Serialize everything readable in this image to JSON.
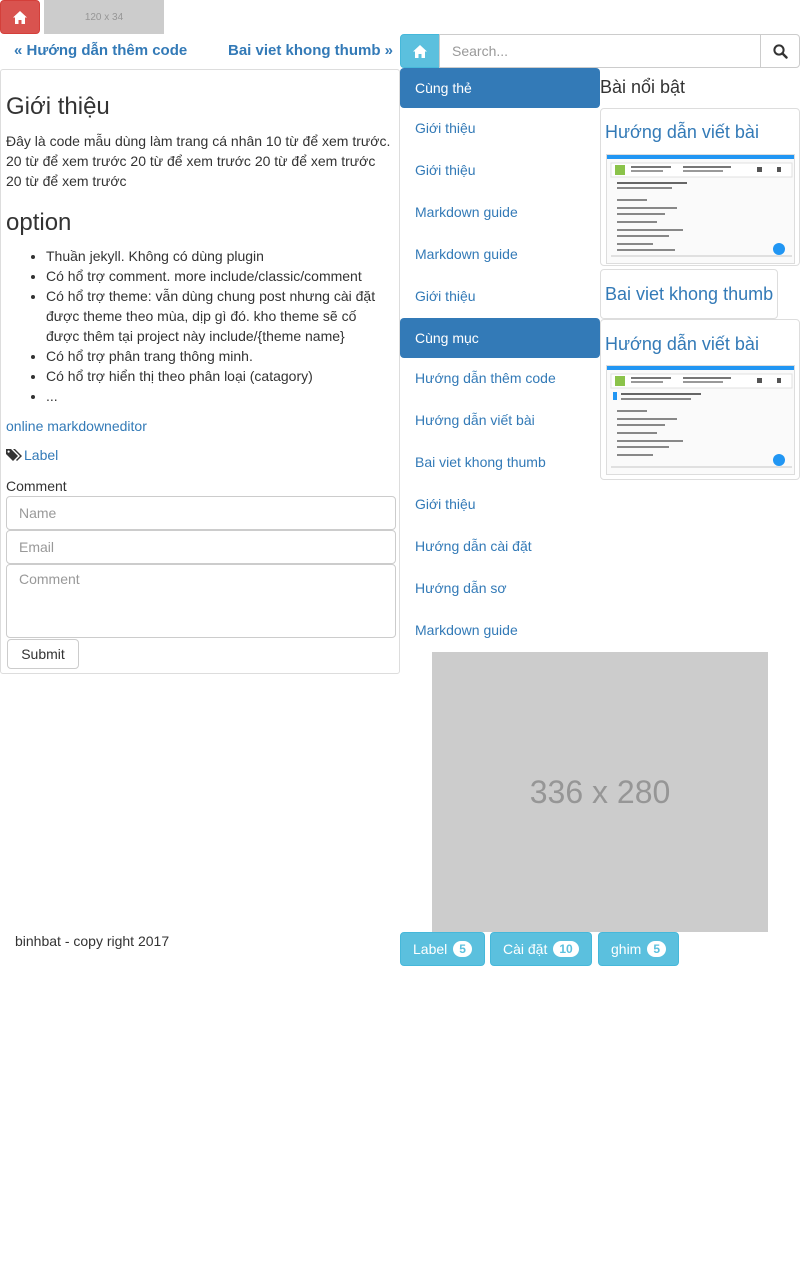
{
  "top": {
    "home_icon": "home-icon",
    "ad_small": "120 x 34"
  },
  "pager": {
    "prev": "« Hướng dẫn thêm code",
    "next": "Bai viet khong thumb »"
  },
  "post": {
    "title": "Giới thiệu",
    "intro": "Đây là code mẫu dùng làm trang cá nhân 10 từ để xem trước. 20 từ để xem trước 20 từ để xem trước 20 từ để xem trước 20 từ để xem trước",
    "section_title": "option",
    "bullets": [
      "Thuần jekyll. Không có dùng plugin",
      "Có hổ trợ comment. more include/classic/comment",
      "Có hổ trợ theme: vẫn dùng chung post nhưng cài đặt được theme theo mùa, dịp gì đó. kho theme sẽ cố được thêm tại project này include/{theme name}",
      "Có hổ trợ phân trang thông minh.",
      "Có hổ trợ hiển thị theo phân loại (catagory)",
      "..."
    ],
    "md_link": "online markdowneditor",
    "tag_label": "Label",
    "comment_title": "Comment",
    "name_placeholder": "Name",
    "email_placeholder": "Email",
    "comment_placeholder": "Comment",
    "submit_label": "Submit"
  },
  "search": {
    "placeholder": "Search..."
  },
  "nav": {
    "same_tag_header": "Cùng thẻ",
    "same_tag_items": [
      "Giới thiệu",
      "Giới thiệu",
      "Markdown guide",
      "Markdown guide",
      "Giới thiệu"
    ],
    "same_cat_header": "Cùng mục",
    "same_cat_items": [
      "Hướng dẫn thêm code",
      "Hướng dẫn viết bài",
      "Bai viet khong thumb",
      "Giới thiệu",
      "Hướng dẫn cài đặt",
      "Hướng dẫn sơ",
      "Markdown guide"
    ]
  },
  "featured": {
    "title": "Bài nổi bật",
    "cards": [
      {
        "title": "Hướng dẫn viết bài"
      },
      {
        "title": "Bai viet khong thumb"
      },
      {
        "title": "Hướng dẫn viết bài"
      }
    ]
  },
  "ad_big": "336 x 280",
  "footer": "binhbat - copy right 2017",
  "labels": [
    {
      "name": "Label",
      "count": "5"
    },
    {
      "name": "Cài đặt",
      "count": "10"
    },
    {
      "name": "ghim",
      "count": "5"
    }
  ],
  "colors": {
    "primary": "#337ab7",
    "info": "#5bc0de",
    "danger": "#d9534f"
  }
}
